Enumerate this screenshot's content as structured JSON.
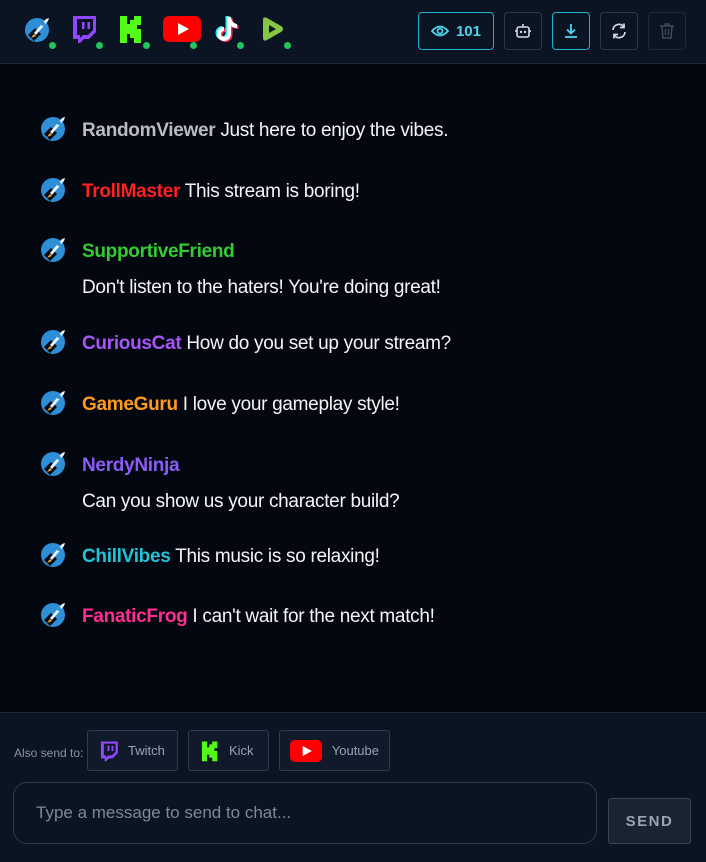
{
  "header": {
    "viewer_count": "101",
    "platforms": [
      "rocket",
      "twitch",
      "kick",
      "youtube",
      "tiktok",
      "rumble"
    ]
  },
  "messages": [
    {
      "user": "RandomViewer",
      "text": "Just here to enjoy the vibes.",
      "color": "#b8bcc4"
    },
    {
      "user": "TrollMaster",
      "text": "This stream is boring!",
      "color": "#ff2020"
    },
    {
      "user": "SupportiveFriend",
      "text": "Don't listen to the haters! You're doing great!",
      "color": "#33cc33"
    },
    {
      "user": "CuriousCat",
      "text": "How do you set up your stream?",
      "color": "#a855f7"
    },
    {
      "user": "GameGuru",
      "text": "I love your gameplay style!",
      "color": "#ff9a1f"
    },
    {
      "user": "NerdyNinja",
      "text": "Can you show us your character build?",
      "color": "#8b5cf6"
    },
    {
      "user": "ChillVibes",
      "text": "This music is so relaxing!",
      "color": "#22c3d9"
    },
    {
      "user": "FanaticFrog",
      "text": "I can't wait for the next match!",
      "color": "#ff2d8f"
    }
  ],
  "footer": {
    "also_send_label": "Also send to:",
    "targets": {
      "twitch": "Twitch",
      "kick": "Kick",
      "youtube": "Youtube"
    },
    "input_placeholder": "Type a message to send to chat...",
    "send_label": "SEND"
  },
  "colors": {
    "accent": "#1fb2cf",
    "twitch": "#9146ff",
    "kick": "#53fc18",
    "youtube": "#ff0000"
  }
}
